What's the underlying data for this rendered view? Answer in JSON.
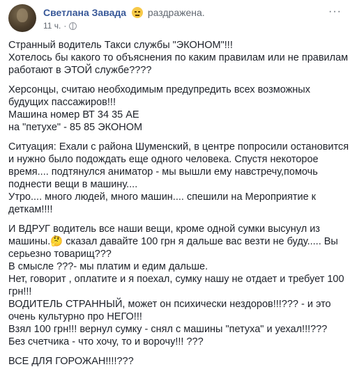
{
  "post": {
    "author": "Светлана Завада",
    "feeling": "раздражена.",
    "time": "11 ч.",
    "paragraphs": [
      [
        "Странный водитель Такси службы \"ЭКОНОМ\"!!!",
        "Хотелось бы какого то объяснения по каким правилам или не правилам",
        "работают в ЭТОЙ службе????"
      ],
      [
        "Херсонцы, считаю необходимым предупредить всех возможных",
        "будущих пассажиров!!!",
        "Машина номер ВТ 34 35 АЕ",
        "на \"петухе\" - 85 85 ЭКОНОМ"
      ],
      [
        "Ситуация: Ехали с района Шуменский, в центре попросили остановится",
        "и нужно было подождать еще одного человека. Спустя некоторое",
        "время.... подтянулся аниматор - мы вышли ему навстречу,помочь",
        "поднести вещи в машину....",
        "Утро.... много людей, много машин.... спешили на Мероприятие к",
        "деткам!!!!"
      ],
      [
        "И ВДРУГ водитель все наши вещи, кроме одной сумки высунул из",
        "машины.🤔 сказал давайте 100 грн я дальше вас везти не буду..... Вы",
        "серьезно товарищ???",
        "В смысле ???- мы платим и едим дальше.",
        "Нет, говорит , оплатите и я поехал, сумку нашу не отдает и требует 100",
        "грн!!!",
        "ВОДИТЕЛЬ СТРАННЫЙ, может он психически нездоров!!!??? - и это",
        "очень культурно про НЕГО!!!",
        "Взял 100 грн!!! вернул сумку - снял с машины \"петуха\" и уехал!!!???",
        "Без счетчика - что хочу, то и ворочу!!! ???"
      ],
      [
        "ВСЕ ДЛЯ ГОРОЖАН!!!!???"
      ]
    ]
  }
}
